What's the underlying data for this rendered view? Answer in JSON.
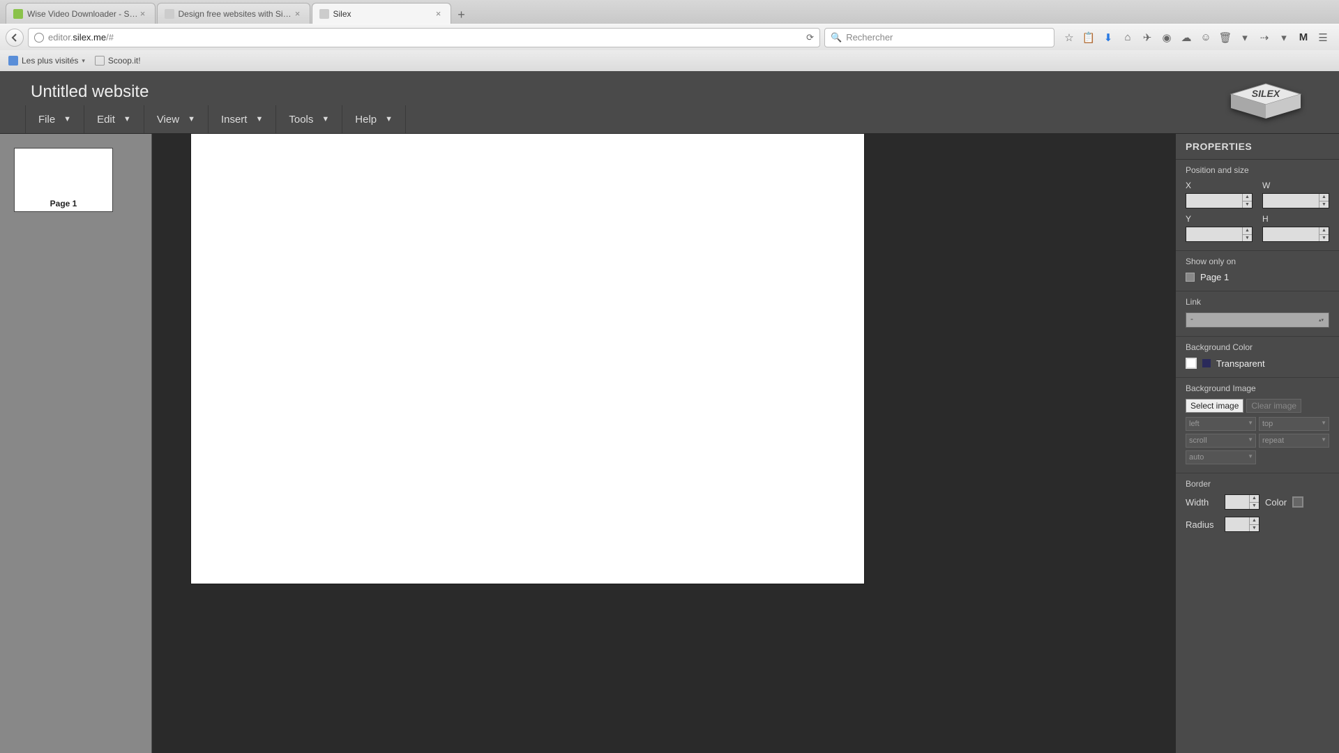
{
  "browser": {
    "tabs": [
      {
        "title": "Wise Video Downloader - S…"
      },
      {
        "title": "Design free websites with Silex"
      },
      {
        "title": "Silex"
      }
    ],
    "url_prefix": "editor.",
    "url_domain": "silex.me",
    "url_suffix": "/#",
    "search_placeholder": "Rechercher",
    "bookmarks": [
      {
        "label": "Les plus visités"
      },
      {
        "label": "Scoop.it!"
      }
    ],
    "toolbar_letter": "M"
  },
  "app": {
    "title": "Untitled website",
    "menu": [
      "File",
      "Edit",
      "View",
      "Insert",
      "Tools",
      "Help"
    ],
    "pages": [
      {
        "label": "Page 1"
      }
    ],
    "logo_text": "SILEX"
  },
  "properties": {
    "header": "PROPERTIES",
    "position_size_title": "Position and size",
    "labels": {
      "x": "X",
      "y": "Y",
      "w": "W",
      "h": "H"
    },
    "show_only_on_title": "Show only on",
    "show_only_on_page": "Page 1",
    "link_title": "Link",
    "link_value": "-",
    "bg_color_title": "Background Color",
    "transparent_label": "Transparent",
    "bg_image_title": "Background Image",
    "select_image_btn": "Select image",
    "clear_image_btn": "Clear image",
    "bg_sel": [
      "left",
      "top",
      "scroll",
      "repeat",
      "auto"
    ],
    "border_title": "Border",
    "width_label": "Width",
    "color_label": "Color",
    "radius_label": "Radius"
  }
}
